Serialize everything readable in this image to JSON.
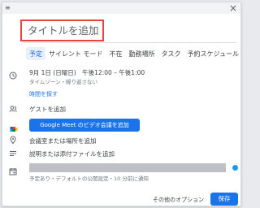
{
  "dialog": {
    "close_glyph": "×",
    "title_placeholder": "タイトルを追加",
    "tabs": [
      "予定",
      "サイレント モード",
      "不在",
      "勤務場所",
      "タスク",
      "予約スケジュール"
    ],
    "active_tab": 0
  },
  "datetime": {
    "line": "9月 1日 (日曜日)　午後12:00 – 午後1:00",
    "sub": "タイムゾーン・繰り返さない",
    "find_time": "時間を探す"
  },
  "guests": {
    "label": "ゲストを追加"
  },
  "meet": {
    "button_label": "Google Meet のビデオ会議を追加"
  },
  "location": {
    "label": "会議室または場所を追加"
  },
  "description": {
    "label": "説明または添付ファイルを追加"
  },
  "calendar": {
    "sub": "予定あり・デフォルトの公開設定・10 分前に通知",
    "dot_color": "#1a9be6"
  },
  "footer": {
    "more_options": "その他のオプション",
    "save": "保存"
  },
  "colors": {
    "accent": "#1a73e8",
    "highlight_border": "#e8433c"
  }
}
